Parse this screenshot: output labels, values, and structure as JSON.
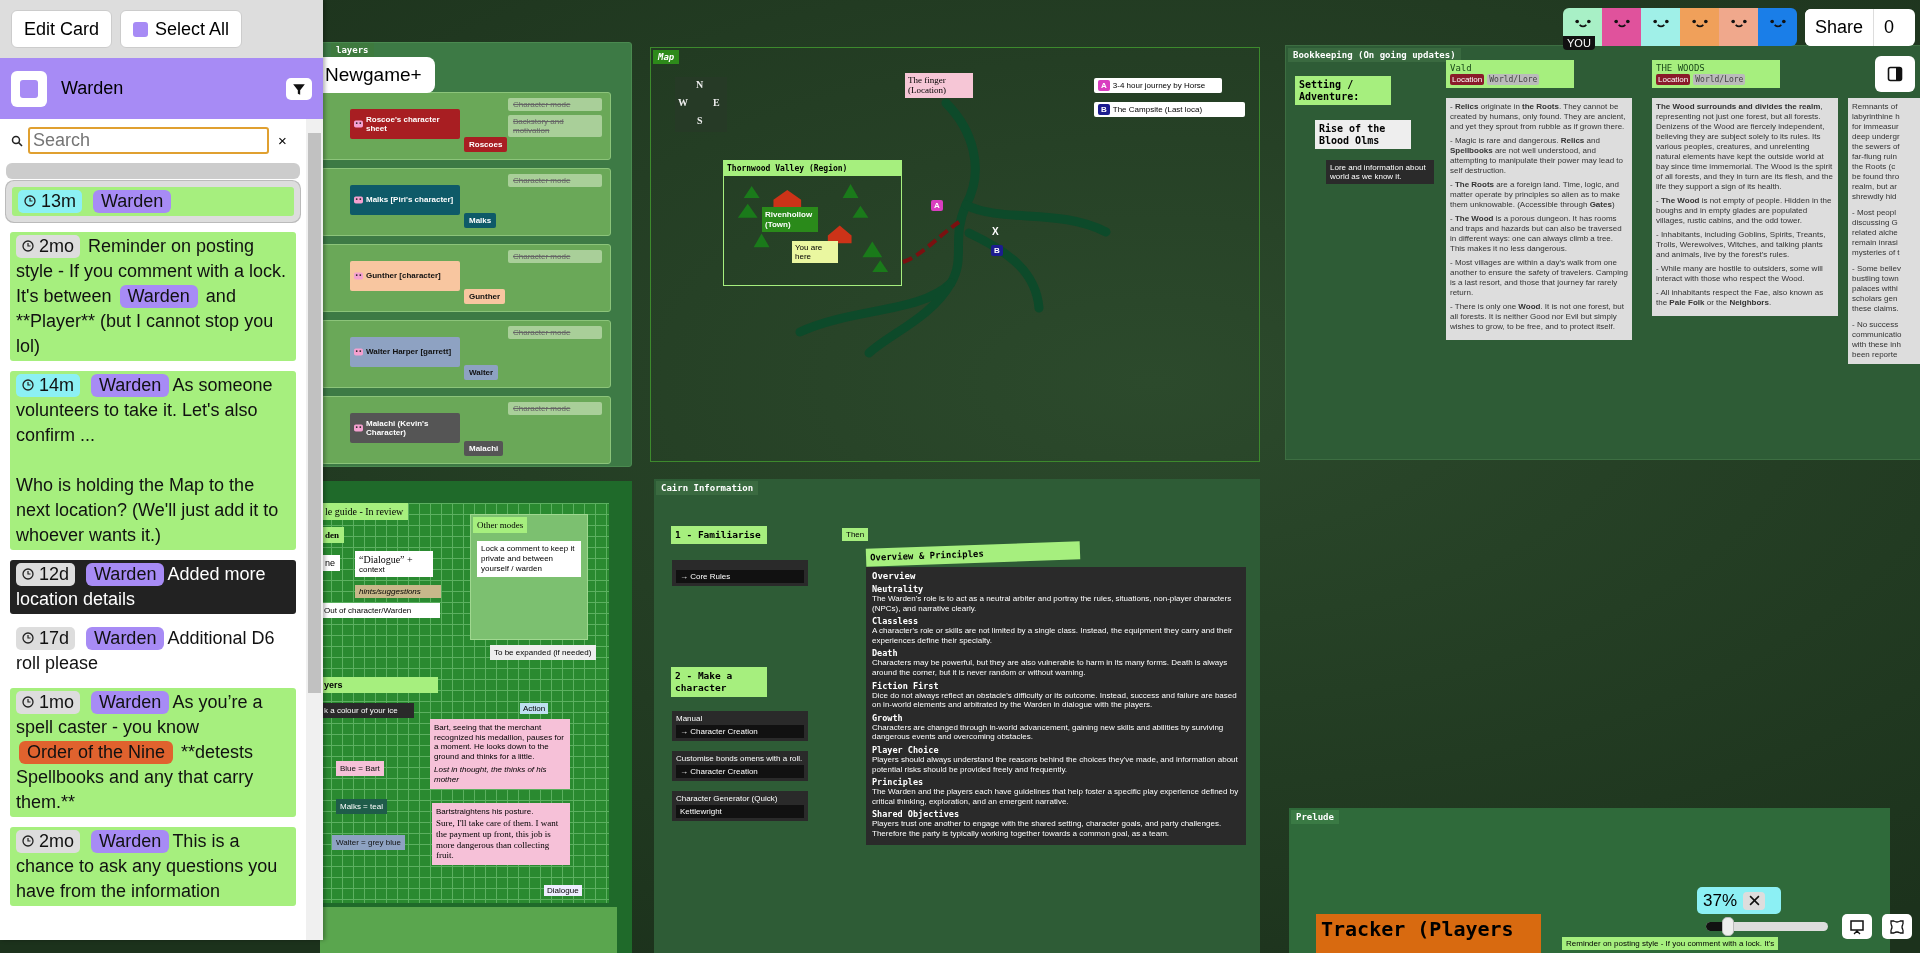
{
  "toolbar": {
    "avatars": [
      {
        "color": "#a8f0c6",
        "label": "YOU"
      },
      {
        "color": "#e0529c"
      },
      {
        "color": "#a0f0e8"
      },
      {
        "color": "#f0a05a"
      },
      {
        "color": "#f0a88c"
      },
      {
        "color": "#1a7ee8"
      }
    ],
    "share": {
      "label": "Share",
      "count": "0"
    }
  },
  "sidebar": {
    "buttons": [
      "Edit Card",
      "Select All"
    ],
    "header": {
      "title": "Warden"
    },
    "search": {
      "placeholder": "Search"
    },
    "clear": "×",
    "comments": [
      {
        "time": "13m",
        "recent": true,
        "selected": true,
        "color": "#a6ef7e",
        "segments": [
          {
            "kind": "tag",
            "text": "Warden",
            "color": "#a78bf5"
          }
        ]
      },
      {
        "time": "2mo",
        "recent": false,
        "selected": false,
        "color": "#a6ef7e",
        "segments": [
          {
            "kind": "text",
            "text": "Reminder on posting style - If you comment with a lock. It's between "
          },
          {
            "kind": "tag",
            "text": "Warden",
            "color": "#a78bf5"
          },
          {
            "kind": "text",
            "text": " and **Player** (but I cannot stop you lol)"
          }
        ]
      },
      {
        "time": "14m",
        "recent": true,
        "selected": false,
        "color": "#a6ef7e",
        "segments": [
          {
            "kind": "tag",
            "text": "Warden",
            "color": "#a78bf5"
          },
          {
            "kind": "text",
            "text": "As someone volunteers to take it. Let's also confirm ...\n\nWho is holding the Map to the next location? (We'll just add it to whoever wants it.)"
          }
        ]
      },
      {
        "time": "12d",
        "recent": false,
        "selected": false,
        "color": "#222222",
        "segments": [
          {
            "kind": "tag",
            "text": "Warden",
            "color": "#a78bf5"
          },
          {
            "kind": "text",
            "text": "Added more location details"
          }
        ]
      },
      {
        "time": "17d",
        "recent": false,
        "selected": false,
        "segments": [
          {
            "kind": "tag",
            "text": "Warden",
            "color": "#a78bf5"
          },
          {
            "kind": "text",
            "text": "Additional D6 roll please"
          }
        ]
      },
      {
        "time": "1mo",
        "recent": false,
        "selected": false,
        "color": "#a6ef7e",
        "segments": [
          {
            "kind": "tag",
            "text": "Warden",
            "color": "#a78bf5"
          },
          {
            "kind": "text",
            "text": "As you’re a spell caster - you know "
          },
          {
            "kind": "tag",
            "text": "Order of the Nine",
            "color": "#e0622e"
          },
          {
            "kind": "text",
            "text": " **detests Spellbooks and any that carry them.**"
          }
        ]
      },
      {
        "time": "2mo",
        "recent": false,
        "selected": false,
        "color": "#a6ef7e",
        "segments": [
          {
            "kind": "tag",
            "text": "Warden",
            "color": "#a78bf5"
          },
          {
            "kind": "text",
            "text": "This is a chance to ask any questions you have from the information"
          }
        ]
      }
    ]
  },
  "players": {
    "title": "layers",
    "label": "Newgame+",
    "rows": [
      {
        "sheet": "Roscoe's character sheet",
        "tag": "Roscoes",
        "color": "#a81e22",
        "modes": [
          "Character mode",
          "Backstory and motivation"
        ]
      },
      {
        "sheet": "Malks [Piri's character]",
        "tag": "Malks",
        "color": "#0e5a68",
        "modes": [
          "Character mode"
        ]
      },
      {
        "sheet": "Gunther [character]",
        "tag": "Gunther",
        "color": "#f8c6a0",
        "modes": [
          "Character mode"
        ]
      },
      {
        "sheet": "Walter Harper [garrett]",
        "tag": "Walter",
        "color": "#8ea2c2",
        "modes": [
          "Character mode"
        ]
      },
      {
        "sheet": "Malachi (Kevin's Character)",
        "tag": "Malachi",
        "color": "#555555",
        "modes": [
          "Character mode"
        ]
      }
    ]
  },
  "map": {
    "title": "Map",
    "compass": [
      "N",
      "W",
      "E",
      "S"
    ],
    "location": "The finger (Location)",
    "region": "Thornwood Valley (Region)",
    "town": "Rivenhollow (Town)",
    "you_are_here": "You are here",
    "x_mark": "X",
    "markers": [
      {
        "letter": "A",
        "color": "#d93ec0"
      },
      {
        "letter": "B",
        "color": "#1c1c8f"
      }
    ],
    "legend": [
      {
        "letter": "A",
        "text": "3-4 hour journey by Horse",
        "color": "#d93ec0"
      },
      {
        "letter": "B",
        "text": "The Campsite (Last loca)",
        "color": "#1c1c8f"
      }
    ]
  },
  "bookkeeping": {
    "title": "Bookkeeping (On going updates)",
    "heading": "Setting / Adventure:",
    "subheading": "Rise of the Blood Olms",
    "note": "Lore and information about world as we know it.",
    "entries": [
      {
        "title": "Vald",
        "tags": [
          "Location",
          "World/Lore"
        ],
        "paragraphs": [
          "- **Relics** originate in **the Roots**. They cannot be created by humans, only found. They are ancient, and yet they sprout from rubble as if grown there.",
          "- Magic is rare and dangerous. **Relics** and **Spellbooks** are not well understood, and attempting to manipulate their power may lead to self destruction.",
          "- **The Roots** are a foreign land. Time, logic, and matter operate by principles so alien as to make them unknowable. (Accessible through **Gates**)",
          "- **The Wood** is a porous dungeon. It has rooms and traps and hazards but can also be traversed in different ways: one can always climb a tree. This makes it no less dangerous.",
          "- Most villages are within a day's walk from one another to ensure the safety of travelers. Camping is a last resort, and those that journey far rarely return.",
          "- There is only one **Wood**. It is not one forest, but all forests. It is neither Good nor Evil but simply wishes to grow, to be free, and to protect itself."
        ]
      },
      {
        "title": "THE WOODS",
        "tags": [
          "Location",
          "World/Lore"
        ],
        "paragraphs": [
          "**The Wood surrounds and divides the realm**, representing not just one forest, but all forests. Denizens of the Wood are fiercely independent, believing they are subject solely to its rules. Its various peoples, creatures, and unrelenting natural elements have kept the outside world at bay since time immemorial. The Wood is the spirit of all forests, and they in turn are its flesh, and the life they support a sign of its health.",
          "- **The Wood** is not empty of people. Hidden in the boughs and in empty glades are populated villages, rustic cabins, and the odd tower.",
          "- Inhabitants, including Goblins, Spirits, Treants, Trolls, Werewolves, Witches, and talking plants and animals, live by the forest's rules.",
          "- While many are hostile to outsiders, some will interact with those who respect the Wood.",
          "- All inhabitants respect the Fae, also known as the **Pale Folk** or the **Neighbors**."
        ]
      }
    ],
    "partial_paragraphs": [
      [
        "Remnants of",
        "labyrinthine h",
        "for immeasur",
        "deep undergr",
        "the sewers of",
        "far-flung ruin",
        "the Roots (c",
        "be found thro",
        "realm, but ar",
        "shrewdly hid"
      ],
      [
        "- Most peopl",
        "discussing G",
        "related alche",
        "remain inrasi",
        "mysteries of t"
      ],
      [
        "- Some believ",
        "bustling town",
        "palaces withi",
        "scholars gen",
        "these claims."
      ],
      [
        "- No success",
        "communicatio",
        "with these inh",
        "been reporte"
      ]
    ]
  },
  "guide": {
    "title": "le guide - In review",
    "role": "den",
    "scene": "ne",
    "dialogue": "“Dialogue” +",
    "dialogue_note": "context",
    "hints": "hints/suggestions",
    "ooc": "Out of character/Warden",
    "other_title": "Other modes",
    "lock_note": "Lock a comment to keep it private and between yourself / warden",
    "expand_note": "To be expanded (if needed)",
    "players_title": "yers",
    "colour_note": "k a colour of your ice",
    "colours": [
      {
        "text": "Blue = Bart",
        "color": "#f6c1d8"
      },
      {
        "text": "Malks = teal",
        "color": "#1f5c4a"
      },
      {
        "text": "Walter = grey blue",
        "color": "#8ea2c2"
      }
    ],
    "action": "Action",
    "bart_text": "Bart, seeing that the merchant recognized his medallion, pauses for a moment. He looks down to the ground and thinks for a little.",
    "bart_thought": "Lost in thought, the thinks of his mother",
    "bart_posture": "Bartstraightens his posture.",
    "bart_speech": "Sure, I'll take care of them. I want the payment up front, this job is more dangerous than collecting fruit.",
    "dialogue_chip": "Dialogue"
  },
  "cairn": {
    "title": "Cairn Information",
    "step1": "1 - Familiarise",
    "core": "→ Core Rules",
    "then": "Then",
    "step2": "2 - Make a character",
    "links": [
      {
        "label": "Manual",
        "target": "→ Character Creation"
      },
      {
        "label": "Customise bonds omens with a roll.",
        "target": "→ Character Creation"
      },
      {
        "label": "Character Generator (Quick)",
        "target": "Kettlewright"
      }
    ],
    "overview_title": "Overview & Principles",
    "overview_heading": "Overview",
    "sections": [
      {
        "heading": "Neutrality",
        "text": "The Warden's role is to act as a neutral arbiter and portray the rules, situations, non-player characters (NPCs), and narrative clearly."
      },
      {
        "heading": "Classless",
        "text": "A character's role or skills are not limited by a single class. Instead, the equipment they carry and their experiences define their specialty."
      },
      {
        "heading": "Death",
        "text": "Characters may be powerful, but they are also vulnerable to harm in its many forms. Death is always around the corner, but it is never random or without warning."
      },
      {
        "heading": "Fiction First",
        "text": "Dice do not always reflect an obstacle's difficulty or its outcome. Instead, success and failure are based on in-world elements and arbitrated by the Warden in dialogue with the players."
      },
      {
        "heading": "Growth",
        "text": "Characters are changed through in-world advancement, gaining new skills and abilities by surviving dangerous events and overcoming obstacles."
      },
      {
        "heading": "Player Choice",
        "text": "Players should always understand the reasons behind the choices they've made, and information about potential risks should be provided freely and frequently."
      },
      {
        "heading": "Principles",
        "text": "The Warden and the players each have guidelines that help foster a specific play experience defined by critical thinking, exploration, and an emergent narrative."
      },
      {
        "heading": "Shared Objectives",
        "text": "Players trust one another to engage with the shared setting, character goals, and party challenges. Therefore the party is typically working together towards a common goal, as a team."
      }
    ]
  },
  "prelude": {
    "title": "Prelude",
    "tracker": "Tracker (Players",
    "reminder": "Reminder on posting style - If you comment with a lock. It's"
  },
  "zoom": {
    "reading": "37%",
    "level": 0.18
  }
}
